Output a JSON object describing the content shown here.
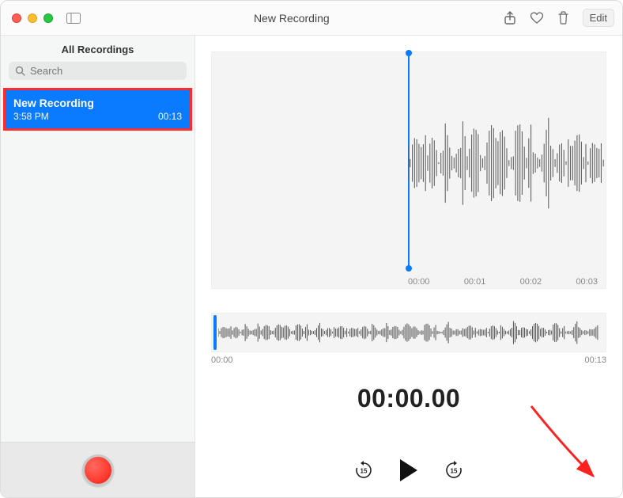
{
  "header": {
    "title": "New Recording",
    "edit_label": "Edit"
  },
  "sidebar": {
    "heading": "All Recordings",
    "search_placeholder": "Search",
    "items": [
      {
        "title": "New Recording",
        "time": "3:58 PM",
        "duration": "00:13"
      }
    ]
  },
  "main": {
    "ticks": [
      "00:00",
      "00:01",
      "00:02",
      "00:03"
    ],
    "overview_start": "00:00",
    "overview_end": "00:13",
    "big_time": "00:00.00",
    "skip_seconds": "15"
  }
}
